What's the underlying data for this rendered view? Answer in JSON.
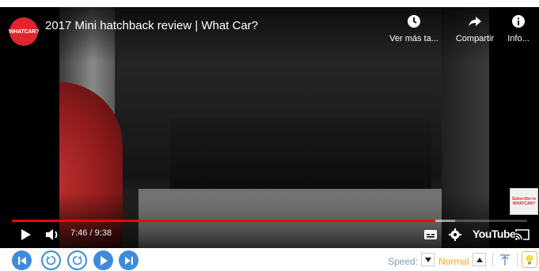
{
  "player": {
    "channel_logo_text": "WHATCAR?",
    "title": "2017 Mini hatchback review | What Car?",
    "actions": [
      {
        "label": "Ver más ta...",
        "icon": "clock-icon"
      },
      {
        "label": "Compartir",
        "icon": "share-icon"
      },
      {
        "label": "Info...",
        "icon": "info-icon"
      }
    ],
    "progress": {
      "played_fraction": 0.822,
      "buffered_fraction": 0.86
    },
    "time_display": "7:46 / 9:38",
    "youtube_logo": "YouTube",
    "subscribe_badge": {
      "line1": "Subscribe to",
      "line2": "WHATCAR?"
    }
  },
  "toolbar": {
    "speed_label": "Speed:",
    "speed_value": "Normal"
  },
  "colors": {
    "progress_red": "#ff0000",
    "toolbar_blue": "#3d8bd9",
    "speed_value": "#f5a623",
    "channel_red": "#e0262c"
  }
}
